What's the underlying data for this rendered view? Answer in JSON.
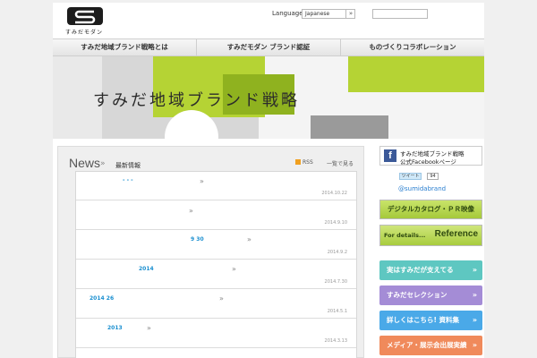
{
  "header": {
    "logo_text": "すみだモダン",
    "language_label": "Language",
    "language_value": "Japanese",
    "language_go": "»",
    "search_placeholder": ""
  },
  "nav": {
    "items": [
      "すみだ地域ブランド戦略とは",
      "すみだモダン ブランド認証",
      "ものづくりコラボレーション"
    ]
  },
  "hero": {
    "title": "すみだ地域ブランド戦略"
  },
  "news": {
    "title": "News",
    "chevron": "»",
    "subtitle": "最新情報",
    "rss_label": "RSS",
    "view_all": "一覧で見る",
    "items": [
      {
        "text": "- - -",
        "date": "2014.10.22"
      },
      {
        "text": "",
        "date": "2014.9.10"
      },
      {
        "text": "9 30",
        "date": "2014.9.2"
      },
      {
        "text": "2014",
        "date": "2014.7.30"
      },
      {
        "text": "2014 26",
        "date": "2014.5.1"
      },
      {
        "text": "2013",
        "date": "2014.3.13"
      }
    ]
  },
  "sidebar": {
    "facebook_icon": "f",
    "facebook_line1": "すみだ地域ブランド戦略",
    "facebook_line2": "公式Facebookページ",
    "tweet_label": "ツイート",
    "tweet_count": "94",
    "twitter_handle": "@sumidabrand",
    "catalog_banner": "デジタルカタログ・ＰＲ映像",
    "reference_small": "For details...",
    "reference_big": "Reference",
    "buttons": [
      {
        "label": "実はすみだが支えてる",
        "color": "#5ec7c1"
      },
      {
        "label": "すみだセレクション",
        "color": "#a48cd6"
      },
      {
        "label": "詳しくはこちら! 資料集",
        "color": "#4aa9e8"
      },
      {
        "label": "メディア・展示会出展実績",
        "color": "#f08a5b"
      }
    ]
  },
  "colors": {
    "accent_green": "#b5d334",
    "link_blue": "#1a8fd0",
    "facebook": "#3b5998"
  }
}
